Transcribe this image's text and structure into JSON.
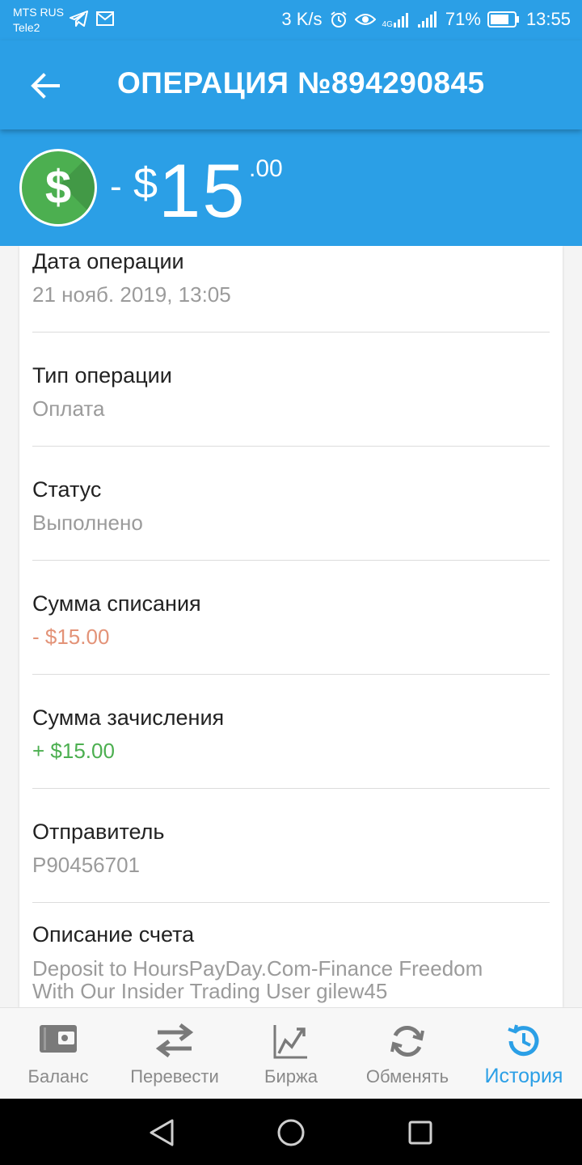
{
  "status_bar": {
    "carrier1": "MTS RUS",
    "carrier2": "Tele2",
    "speed": "3 K/s",
    "network": "4G",
    "battery": "71%",
    "time": "13:55"
  },
  "app_bar": {
    "title": "ОПЕРАЦИЯ №894290845",
    "back_icon": "arrow-left-icon"
  },
  "amount": {
    "sign": "-",
    "currency": "$",
    "integer": "15",
    "decimal": ".00",
    "icon": "dollar-icon"
  },
  "details": [
    {
      "label": "Дата операции",
      "value": "21 нояб. 2019, 13:05"
    },
    {
      "label": "Тип операции",
      "value": "Оплата"
    },
    {
      "label": "Статус",
      "value": "Выполнено"
    },
    {
      "label": "Сумма списания",
      "value": "- $15.00"
    },
    {
      "label": "Сумма зачисления",
      "value": "+ $15.00"
    },
    {
      "label": "Отправитель",
      "value": "P90456701"
    },
    {
      "label": "Описание счета",
      "value_line1": "Deposit to HoursPayDay.Com-Finance Freedom",
      "value_line2": "With Our Insider Trading User gilew45"
    }
  ],
  "colors": {
    "primary": "#2b9fe6",
    "debit": "#e39378",
    "credit": "#4caf50"
  },
  "bottom_nav": [
    {
      "label": "Баланс",
      "icon": "wallet-icon",
      "active": false
    },
    {
      "label": "Перевести",
      "icon": "transfer-icon",
      "active": false
    },
    {
      "label": "Биржа",
      "icon": "chart-icon",
      "active": false
    },
    {
      "label": "Обменять",
      "icon": "exchange-icon",
      "active": false
    },
    {
      "label": "История",
      "icon": "history-icon",
      "active": true
    }
  ]
}
